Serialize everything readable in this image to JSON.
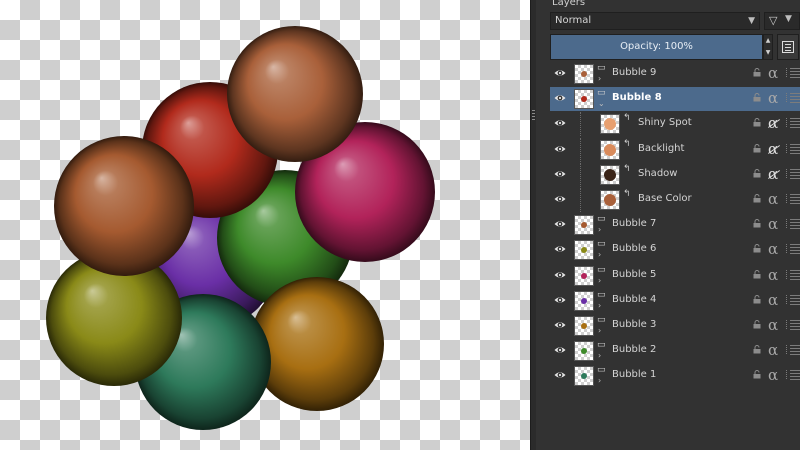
{
  "panel": {
    "title": "Layers",
    "blend_mode": "Normal",
    "opacity_label": "Opacity:  100%"
  },
  "colors": {
    "selection": "#4c6a8c",
    "panel_bg": "#323232"
  },
  "bubbles": [
    {
      "name": "purple",
      "color": "#6a2fa6"
    },
    {
      "name": "green",
      "color": "#3e8a2a"
    },
    {
      "name": "red",
      "color": "#b12a1c"
    },
    {
      "name": "magenta",
      "color": "#b2235a"
    },
    {
      "name": "orange",
      "color": "#a86f12"
    },
    {
      "name": "teal",
      "color": "#2e7a5b"
    },
    {
      "name": "olive",
      "color": "#8a8a18"
    },
    {
      "name": "copper-left",
      "color": "#a55a30"
    },
    {
      "name": "copper-top",
      "color": "#a9603a"
    }
  ],
  "layers": [
    {
      "name": "Bubble 9",
      "type": "group",
      "selected": false,
      "indent": 0,
      "thumb": "#a9603a",
      "alpha": "locked"
    },
    {
      "name": "Bubble 8",
      "type": "group",
      "selected": true,
      "indent": 0,
      "thumb": "#b12a1c",
      "alpha": "locked"
    },
    {
      "name": "Shiny Spot",
      "type": "layer",
      "selected": false,
      "indent": 1,
      "thumb": "#e8a070",
      "alpha": "off"
    },
    {
      "name": "Backlight",
      "type": "layer",
      "selected": false,
      "indent": 1,
      "thumb": "#d98a5a",
      "alpha": "off"
    },
    {
      "name": "Shadow",
      "type": "layer",
      "selected": false,
      "indent": 1,
      "thumb": "#3a2418",
      "alpha": "off"
    },
    {
      "name": "Base Color",
      "type": "layer",
      "selected": false,
      "indent": 1,
      "thumb": "#a9603a",
      "alpha": "locked"
    },
    {
      "name": "Bubble 7",
      "type": "group",
      "selected": false,
      "indent": 0,
      "thumb": "#a55a30",
      "alpha": "locked"
    },
    {
      "name": "Bubble 6",
      "type": "group",
      "selected": false,
      "indent": 0,
      "thumb": "#8a8a18",
      "alpha": "locked"
    },
    {
      "name": "Bubble 5",
      "type": "group",
      "selected": false,
      "indent": 0,
      "thumb": "#b2235a",
      "alpha": "locked"
    },
    {
      "name": "Bubble 4",
      "type": "group",
      "selected": false,
      "indent": 0,
      "thumb": "#6a2fa6",
      "alpha": "locked"
    },
    {
      "name": "Bubble 3",
      "type": "group",
      "selected": false,
      "indent": 0,
      "thumb": "#a86f12",
      "alpha": "locked"
    },
    {
      "name": "Bubble 2",
      "type": "group",
      "selected": false,
      "indent": 0,
      "thumb": "#3e8a2a",
      "alpha": "locked"
    },
    {
      "name": "Bubble 1",
      "type": "group",
      "selected": false,
      "indent": 0,
      "thumb": "#2e7a5b",
      "alpha": "locked"
    }
  ]
}
